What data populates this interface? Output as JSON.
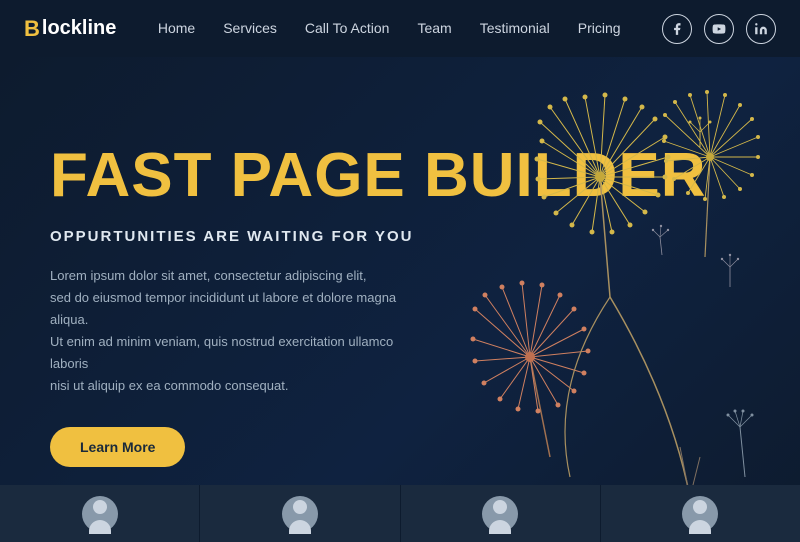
{
  "nav": {
    "logo_b": "B",
    "logo_rest": "lockline",
    "links": [
      {
        "label": "Home",
        "href": "#"
      },
      {
        "label": "Services",
        "href": "#"
      },
      {
        "label": "Call To Action",
        "href": "#"
      },
      {
        "label": "Team",
        "href": "#"
      },
      {
        "label": "Testimonial",
        "href": "#"
      },
      {
        "label": "Pricing",
        "href": "#"
      }
    ],
    "social": [
      {
        "name": "facebook",
        "icon": "f"
      },
      {
        "name": "youtube",
        "icon": "▶"
      },
      {
        "name": "linkedin",
        "icon": "in"
      }
    ]
  },
  "hero": {
    "title": "FAST PAGE BUILDER",
    "subtitle": "OPPURTUNITIES ARE WAITING FOR YOU",
    "body": "Lorem ipsum dolor sit amet, consectetur adipiscing elit,\nsed do eiusmod tempor incididunt ut labore et dolore magna aliqua.\nUt enim ad minim veniam, quis nostrud exercitation ullamco laboris\nnisi ut aliquip ex ea commodo consequat.",
    "cta_label": "Learn More"
  },
  "colors": {
    "accent": "#f0c040",
    "bg": "#0d1b2e",
    "card_bg": "#1a2a3e"
  }
}
